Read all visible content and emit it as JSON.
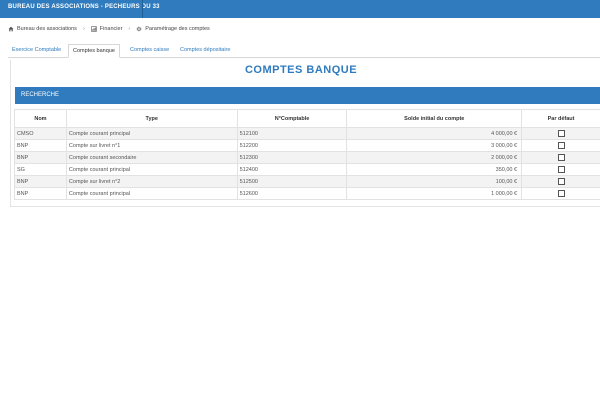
{
  "header": {
    "title": "BUREAU DES ASSOCIATIONS - PECHEURS DU 33"
  },
  "breadcrumb": {
    "items": [
      {
        "label": "Bureau des associations",
        "icon": "home-icon"
      },
      {
        "label": "Financier",
        "icon": "chart-icon"
      },
      {
        "label": "Paramétrage des comptes",
        "icon": "gear-icon"
      }
    ]
  },
  "tabs": [
    {
      "label": "Exercice Comptable"
    },
    {
      "label": "Comptes banque",
      "active": true
    },
    {
      "label": "Comptes caisse"
    },
    {
      "label": "Comptes dépositaire"
    }
  ],
  "main": {
    "title": "COMPTES BANQUE",
    "search_label": "RECHERCHE"
  },
  "table": {
    "columns": [
      "Nom",
      "Type",
      "N°Comptable",
      "Solde initial du compte",
      "Par défaut"
    ],
    "rows": [
      [
        "CMSO",
        "Compte courant principal",
        "512100",
        "4 000,00 €",
        ""
      ],
      [
        "BNP",
        "Compte sur livret n°1",
        "512200",
        "3 000,00 €",
        ""
      ],
      [
        "BNP",
        "Compte courant secondaire",
        "512300",
        "2 000,00 €",
        ""
      ],
      [
        "SG",
        "Compte courant principal",
        "512400",
        "350,00 €",
        ""
      ],
      [
        "BNP",
        "Compte sur livret n°2",
        "512500",
        "100,00 €",
        ""
      ],
      [
        "BNP",
        "Compte courant principal",
        "512600",
        "1 000,00 €",
        ""
      ]
    ]
  },
  "colors": {
    "accent": "#2f7bbd"
  }
}
